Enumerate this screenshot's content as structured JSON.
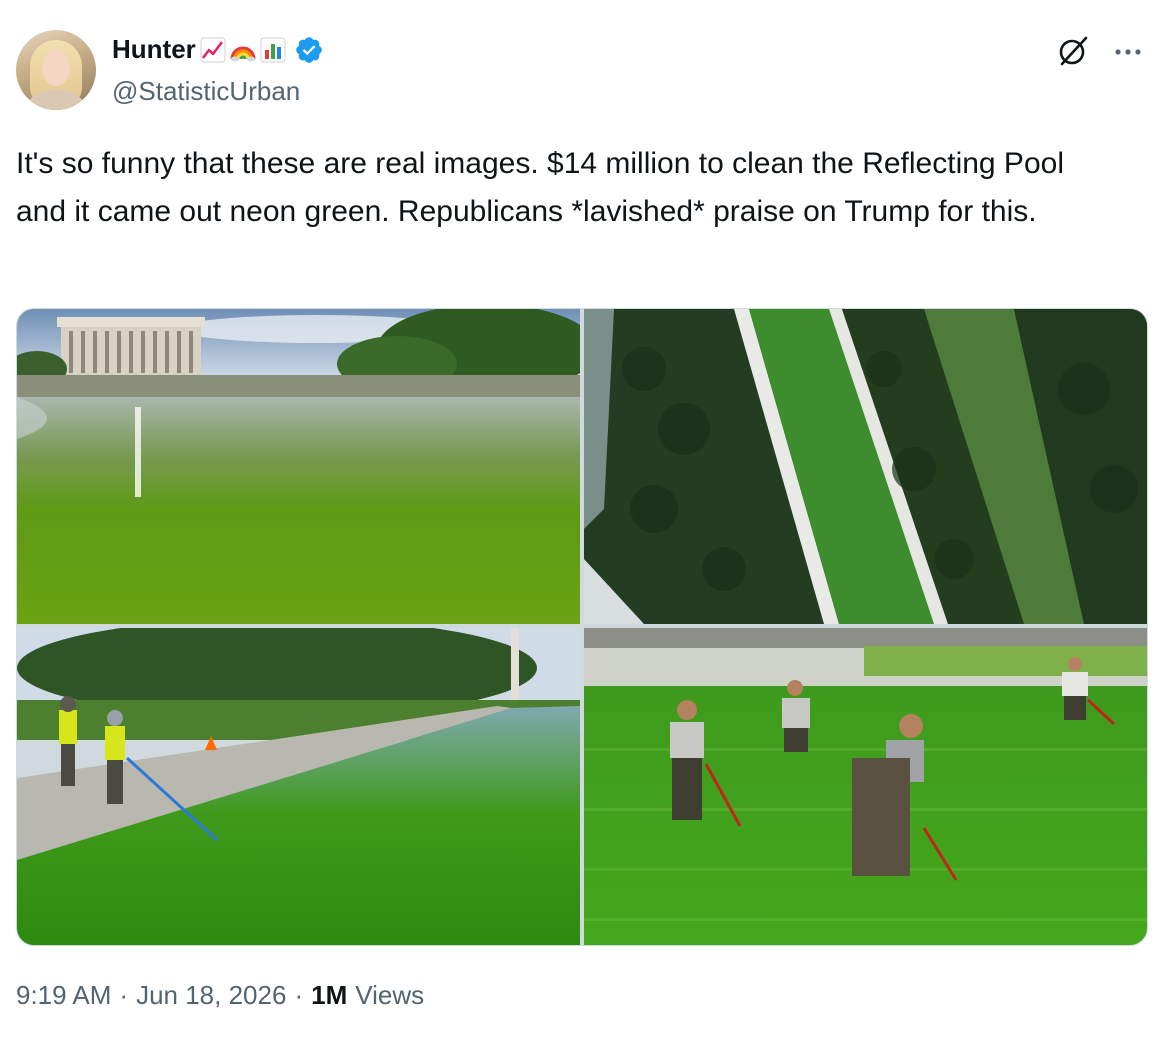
{
  "author": {
    "display_name": "Hunter",
    "handle": "@StatisticUrban",
    "name_emojis": [
      "chart-increasing-emoji",
      "rainbow-emoji",
      "bar-chart-emoji"
    ],
    "verified": true,
    "verified_color": "#1d9bf0"
  },
  "tweet": {
    "text": "It's so funny that these are real images. $14 million to clean the Reflecting Pool and it came out neon green. Republicans *lavished* praise on Trump for this."
  },
  "media": {
    "count": 4,
    "accent_water_color": "#3f9a1a"
  },
  "meta": {
    "time": "9:19 AM",
    "separator": "·",
    "date": "Jun 18, 2026",
    "views_count": "1M",
    "views_label": "Views"
  },
  "actions": {
    "grok_icon": "grok-icon",
    "more_icon": "more-options-icon"
  },
  "colors": {
    "text_primary": "#0f1419",
    "text_secondary": "#536471",
    "border": "#cfd9de"
  }
}
